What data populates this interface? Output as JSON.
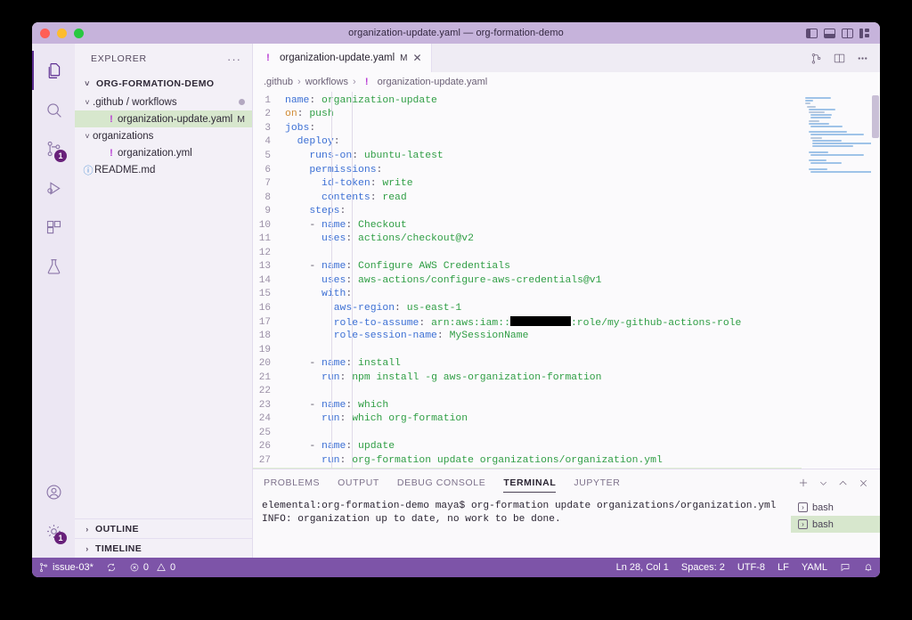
{
  "window": {
    "title": "organization-update.yaml — org-formation-demo",
    "layout_icons": [
      "toggle-primary-sidebar",
      "toggle-panel",
      "toggle-secondary-sidebar",
      "customize-layout"
    ]
  },
  "activity_bar": {
    "items": [
      {
        "name": "explorer",
        "icon": "files-icon",
        "active": true,
        "badge": ""
      },
      {
        "name": "search",
        "icon": "search-icon",
        "active": false,
        "badge": ""
      },
      {
        "name": "source-control",
        "icon": "source-control-icon",
        "active": false,
        "badge": "1"
      },
      {
        "name": "run-and-debug",
        "icon": "run-debug-icon",
        "active": false,
        "badge": ""
      },
      {
        "name": "extensions",
        "icon": "extensions-icon",
        "active": false,
        "badge": ""
      },
      {
        "name": "testing",
        "icon": "beaker-icon",
        "active": false,
        "badge": ""
      }
    ],
    "bottom": [
      {
        "name": "accounts",
        "icon": "account-icon",
        "badge": ""
      },
      {
        "name": "manage",
        "icon": "gear-icon",
        "badge": "1"
      }
    ]
  },
  "sidebar": {
    "header": "EXPLORER",
    "more_actions": "···",
    "root": "ORG-FORMATION-DEMO",
    "items": [
      {
        "label": ".github / workflows",
        "type": "folder",
        "depth": 1,
        "expanded": true,
        "status": "",
        "dot": true
      },
      {
        "label": "organization-update.yaml",
        "type": "yaml",
        "depth": 2,
        "selected": true,
        "status": "M",
        "dot": false
      },
      {
        "label": "organizations",
        "type": "folder",
        "depth": 1,
        "expanded": true,
        "status": "",
        "dot": false
      },
      {
        "label": "organization.yml",
        "type": "yaml",
        "depth": 2,
        "selected": false,
        "status": "",
        "dot": false
      },
      {
        "label": "README.md",
        "type": "markdown",
        "depth": 1,
        "selected": false,
        "status": "",
        "dot": false
      }
    ],
    "collapsed_sections": [
      "OUTLINE",
      "TIMELINE"
    ]
  },
  "editor": {
    "tab": {
      "label": "organization-update.yaml",
      "modified_flag": "M",
      "close": "✕",
      "icon": "yaml-icon"
    },
    "actions": [
      "open-changes-icon",
      "split-editor-icon",
      "more-actions-icon"
    ],
    "breadcrumb": [
      ".github",
      "workflows",
      "organization-update.yaml"
    ],
    "breadcrumb_separator": "›",
    "active_line": 28,
    "lines": [
      {
        "n": 1,
        "tokens": [
          {
            "t": "name",
            "c": "k"
          },
          {
            "t": ": ",
            "c": "p"
          },
          {
            "t": "organization-update",
            "c": "s"
          }
        ]
      },
      {
        "n": 2,
        "tokens": [
          {
            "t": "on",
            "c": "o"
          },
          {
            "t": ": ",
            "c": "p"
          },
          {
            "t": "push",
            "c": "s"
          }
        ]
      },
      {
        "n": 3,
        "tokens": [
          {
            "t": "jobs",
            "c": "k"
          },
          {
            "t": ":",
            "c": "p"
          }
        ]
      },
      {
        "n": 4,
        "tokens": [
          {
            "t": "  ",
            "c": "p"
          },
          {
            "t": "deploy",
            "c": "k"
          },
          {
            "t": ":",
            "c": "p"
          }
        ]
      },
      {
        "n": 5,
        "tokens": [
          {
            "t": "    ",
            "c": "p"
          },
          {
            "t": "runs-on",
            "c": "k"
          },
          {
            "t": ": ",
            "c": "p"
          },
          {
            "t": "ubuntu-latest",
            "c": "s"
          }
        ]
      },
      {
        "n": 6,
        "tokens": [
          {
            "t": "    ",
            "c": "p"
          },
          {
            "t": "permissions",
            "c": "k"
          },
          {
            "t": ":",
            "c": "p"
          }
        ]
      },
      {
        "n": 7,
        "tokens": [
          {
            "t": "      ",
            "c": "p"
          },
          {
            "t": "id-token",
            "c": "k"
          },
          {
            "t": ": ",
            "c": "p"
          },
          {
            "t": "write",
            "c": "s"
          }
        ]
      },
      {
        "n": 8,
        "tokens": [
          {
            "t": "      ",
            "c": "p"
          },
          {
            "t": "contents",
            "c": "k"
          },
          {
            "t": ": ",
            "c": "p"
          },
          {
            "t": "read",
            "c": "s"
          }
        ]
      },
      {
        "n": 9,
        "tokens": [
          {
            "t": "    ",
            "c": "p"
          },
          {
            "t": "steps",
            "c": "k"
          },
          {
            "t": ":",
            "c": "p"
          }
        ]
      },
      {
        "n": 10,
        "tokens": [
          {
            "t": "    - ",
            "c": "p"
          },
          {
            "t": "name",
            "c": "k"
          },
          {
            "t": ": ",
            "c": "p"
          },
          {
            "t": "Checkout",
            "c": "s"
          }
        ]
      },
      {
        "n": 11,
        "tokens": [
          {
            "t": "      ",
            "c": "p"
          },
          {
            "t": "uses",
            "c": "k"
          },
          {
            "t": ": ",
            "c": "p"
          },
          {
            "t": "actions/checkout@v2",
            "c": "s"
          }
        ]
      },
      {
        "n": 12,
        "tokens": []
      },
      {
        "n": 13,
        "tokens": [
          {
            "t": "    - ",
            "c": "p"
          },
          {
            "t": "name",
            "c": "k"
          },
          {
            "t": ": ",
            "c": "p"
          },
          {
            "t": "Configure AWS Credentials",
            "c": "s"
          }
        ]
      },
      {
        "n": 14,
        "tokens": [
          {
            "t": "      ",
            "c": "p"
          },
          {
            "t": "uses",
            "c": "k"
          },
          {
            "t": ": ",
            "c": "p"
          },
          {
            "t": "aws-actions/configure-aws-credentials@v1",
            "c": "s"
          }
        ]
      },
      {
        "n": 15,
        "tokens": [
          {
            "t": "      ",
            "c": "p"
          },
          {
            "t": "with",
            "c": "k"
          },
          {
            "t": ":",
            "c": "p"
          }
        ]
      },
      {
        "n": 16,
        "tokens": [
          {
            "t": "        ",
            "c": "p"
          },
          {
            "t": "aws-region",
            "c": "k"
          },
          {
            "t": ": ",
            "c": "p"
          },
          {
            "t": "us-east-1",
            "c": "s"
          }
        ]
      },
      {
        "n": 17,
        "tokens": [
          {
            "t": "        ",
            "c": "p"
          },
          {
            "t": "role-to-assume",
            "c": "k"
          },
          {
            "t": ": ",
            "c": "p"
          },
          {
            "t": "arn:aws:iam::",
            "c": "s"
          },
          {
            "t": "",
            "c": "redact"
          },
          {
            "t": ":role/my-github-actions-role",
            "c": "s"
          }
        ]
      },
      {
        "n": 18,
        "tokens": [
          {
            "t": "        ",
            "c": "p"
          },
          {
            "t": "role-session-name",
            "c": "k"
          },
          {
            "t": ": ",
            "c": "p"
          },
          {
            "t": "MySessionName",
            "c": "s"
          }
        ]
      },
      {
        "n": 19,
        "tokens": []
      },
      {
        "n": 20,
        "tokens": [
          {
            "t": "    - ",
            "c": "p"
          },
          {
            "t": "name",
            "c": "k"
          },
          {
            "t": ": ",
            "c": "p"
          },
          {
            "t": "install",
            "c": "s"
          }
        ]
      },
      {
        "n": 21,
        "tokens": [
          {
            "t": "      ",
            "c": "p"
          },
          {
            "t": "run",
            "c": "k"
          },
          {
            "t": ": ",
            "c": "p"
          },
          {
            "t": "npm install -g aws-organization-formation",
            "c": "s"
          }
        ]
      },
      {
        "n": 22,
        "tokens": []
      },
      {
        "n": 23,
        "tokens": [
          {
            "t": "    - ",
            "c": "p"
          },
          {
            "t": "name",
            "c": "k"
          },
          {
            "t": ": ",
            "c": "p"
          },
          {
            "t": "which",
            "c": "s"
          }
        ]
      },
      {
        "n": 24,
        "tokens": [
          {
            "t": "      ",
            "c": "p"
          },
          {
            "t": "run",
            "c": "k"
          },
          {
            "t": ": ",
            "c": "p"
          },
          {
            "t": "which org-formation",
            "c": "s"
          }
        ]
      },
      {
        "n": 25,
        "tokens": []
      },
      {
        "n": 26,
        "tokens": [
          {
            "t": "    - ",
            "c": "p"
          },
          {
            "t": "name",
            "c": "k"
          },
          {
            "t": ": ",
            "c": "p"
          },
          {
            "t": "update",
            "c": "s"
          }
        ]
      },
      {
        "n": 27,
        "tokens": [
          {
            "t": "      ",
            "c": "p"
          },
          {
            "t": "run",
            "c": "k"
          },
          {
            "t": ": ",
            "c": "p"
          },
          {
            "t": "org-formation update organizations/organization.yml",
            "c": "s"
          }
        ]
      },
      {
        "n": 28,
        "tokens": []
      }
    ]
  },
  "panel": {
    "tabs": [
      {
        "label": "PROBLEMS",
        "active": false
      },
      {
        "label": "OUTPUT",
        "active": false
      },
      {
        "label": "DEBUG CONSOLE",
        "active": false
      },
      {
        "label": "TERMINAL",
        "active": true
      },
      {
        "label": "JUPYTER",
        "active": false
      }
    ],
    "actions": [
      "new-terminal-icon",
      "chevron-down-icon",
      "maximize-panel-icon",
      "close-panel-icon"
    ],
    "terminal_lines": [
      "elemental:org-formation-demo maya$ org-formation update organizations/organization.yml",
      "INFO: organization up to date, no work to be done."
    ],
    "terminal_list": [
      {
        "label": "bash",
        "selected": false
      },
      {
        "label": "bash",
        "selected": true
      }
    ]
  },
  "status_bar": {
    "branch": "issue-03*",
    "sync_icon": "sync-icon",
    "errors": "0",
    "warnings": "0",
    "position": "Ln 28, Col 1",
    "indentation": "Spaces: 2",
    "encoding": "UTF-8",
    "eol": "LF",
    "language": "YAML",
    "feedback_icon": "feedback-icon",
    "bell_icon": "bell-icon"
  },
  "colors": {
    "titlebar": "#c6b3db",
    "status_bar": "#7d54a8",
    "accent": "#5c2e91",
    "selection_green": "#d7e7cd",
    "active_line": "#ddeed2",
    "key_blue": "#3b6fd4",
    "value_green": "#2f9e44"
  }
}
